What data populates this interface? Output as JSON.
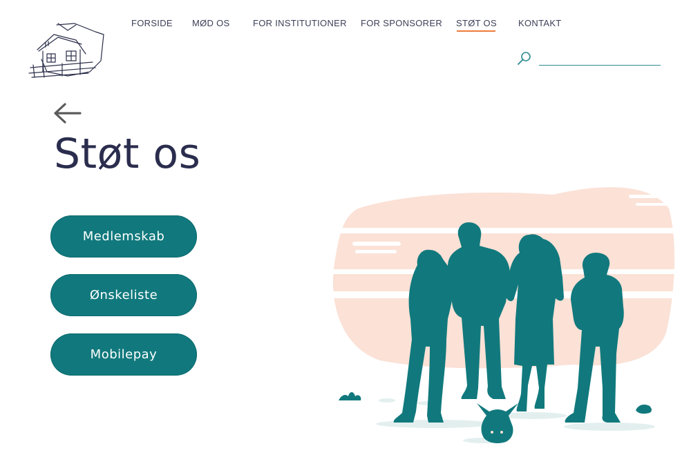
{
  "colors": {
    "primary": "#11797d",
    "accent": "#ee7b3d",
    "title": "#2b2d4e",
    "peach": "#fbe1d6"
  },
  "logo": {
    "icon": "house-sketch-logo-icon"
  },
  "nav": {
    "items": [
      {
        "label": "FORSIDE",
        "active": false
      },
      {
        "label": "MØD OS",
        "active": false
      },
      {
        "label": "FOR INSTITUTIONER",
        "active": false
      },
      {
        "label": "FOR SPONSORER",
        "active": false
      },
      {
        "label": "STØT OS",
        "active": true
      },
      {
        "label": "KONTAKT",
        "active": false
      }
    ]
  },
  "search": {
    "icon": "search-icon",
    "value": "",
    "placeholder": ""
  },
  "back": {
    "icon": "arrow-left-icon"
  },
  "page": {
    "title": "Støt os"
  },
  "buttons": [
    {
      "label": "Medlemskab"
    },
    {
      "label": "Ønskeliste"
    },
    {
      "label": "Mobilepay"
    }
  ],
  "illustration": {
    "icon": "people-silhouette-illustration"
  }
}
